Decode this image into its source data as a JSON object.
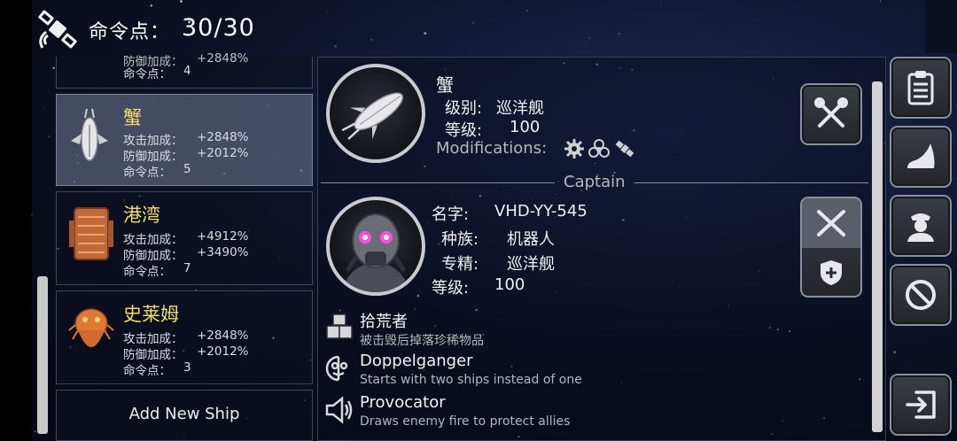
{
  "header": {
    "title": "命令点：",
    "value": "30/30",
    "icon": "satellite-icon"
  },
  "ships": [
    {
      "name": "",
      "attack_label": "",
      "attack": "",
      "defense_label": "防御加成：",
      "defense": "+2848%",
      "cmd_label": "命令点：",
      "cmd": "4"
    },
    {
      "name": "蟹",
      "attack_label": "攻击加成：",
      "attack": "+2848%",
      "defense_label": "防御加成：",
      "defense": "+2012%",
      "cmd_label": "命令点：",
      "cmd": "5"
    },
    {
      "name": "港湾",
      "attack_label": "攻击加成：",
      "attack": "+4912%",
      "defense_label": "防御加成：",
      "defense": "+3490%",
      "cmd_label": "命令点：",
      "cmd": "7"
    },
    {
      "name": "史莱姆",
      "attack_label": "攻击加成：",
      "attack": "+2848%",
      "defense_label": "防御加成：",
      "defense": "+2012%",
      "cmd_label": "命令点：",
      "cmd": "3"
    }
  ],
  "add_ship_label": "Add New Ship",
  "ship_detail": {
    "name": "蟹",
    "class_label": "级别:",
    "class_value": "巡洋舰",
    "level_label": "等级:",
    "level_value": "100",
    "mods_label": "Modifications:",
    "mod_icons": [
      "gear-icon",
      "biohazard-icon",
      "satellite-icon"
    ]
  },
  "captain": {
    "section_label": "Captain",
    "name_label": "名字:",
    "name_value": "VHD-YY-545",
    "race_label": "种族:",
    "race_value": "机器人",
    "spec_label": "专精:",
    "spec_value": "巡洋舰",
    "level_label": "等级:",
    "level_value": "100"
  },
  "abilities": [
    {
      "title": "拾荒者",
      "desc": "被击毁后掉落珍稀物品",
      "icon": "crates-icon"
    },
    {
      "title": "Doppelganger",
      "desc": "Starts with two ships instead of one",
      "icon": "mask-face-icon"
    },
    {
      "title": "Provocator",
      "desc": "Draws enemy fire to protect allies",
      "icon": "megaphone-icon"
    }
  ],
  "colors": {
    "ship_name": "#f2dc6c",
    "selected_card": "#5c647a",
    "background": "#0a0e1c"
  }
}
